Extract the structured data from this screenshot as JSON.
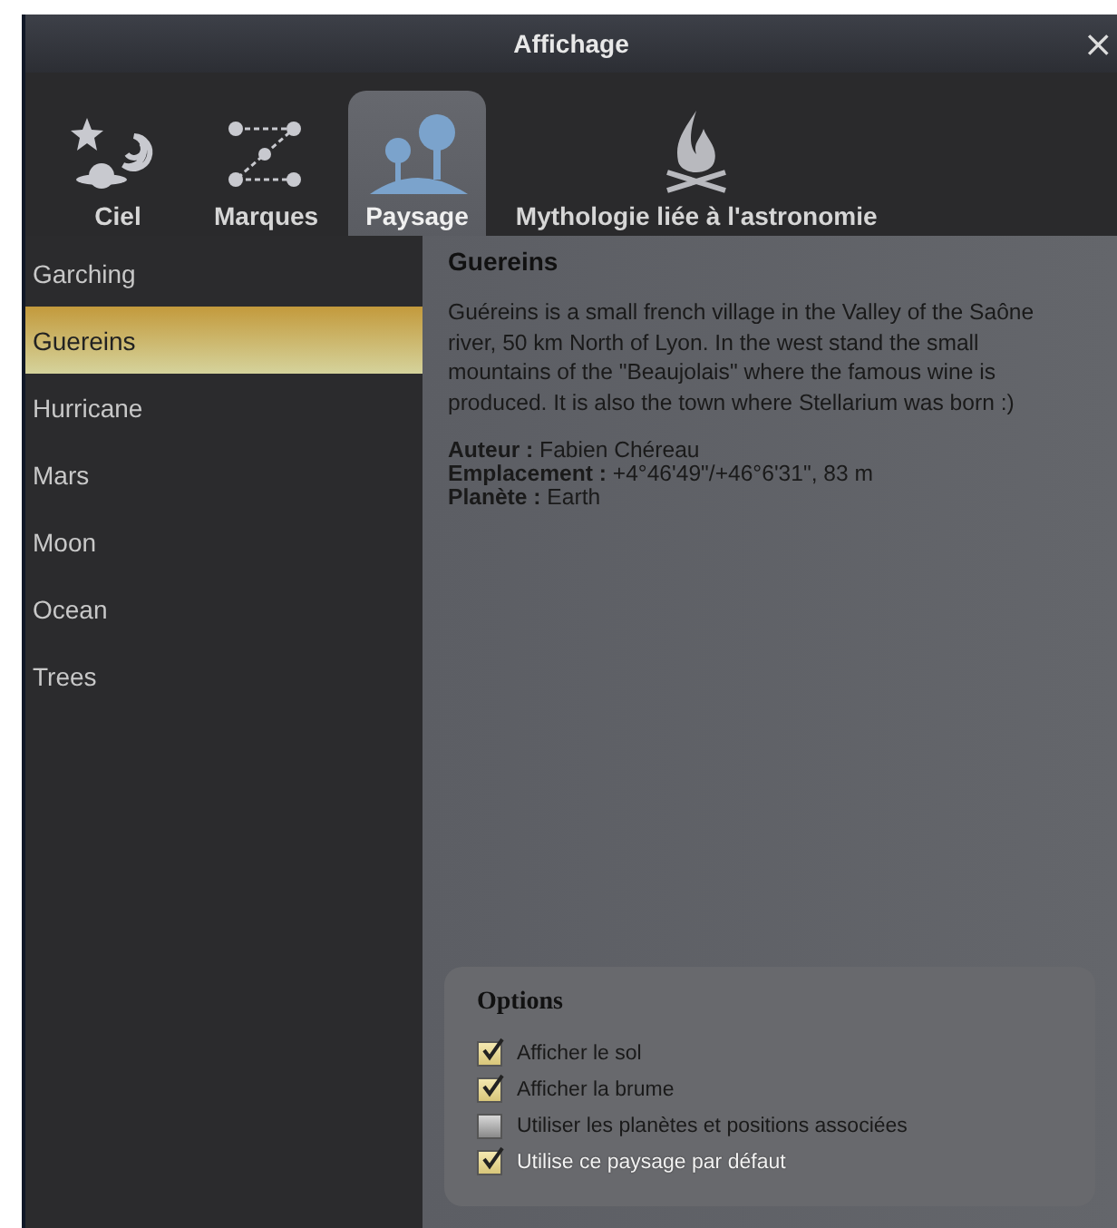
{
  "window": {
    "title": "Affichage",
    "close": "×"
  },
  "tabs": [
    {
      "label": "Ciel",
      "kind": "sky",
      "selected": false
    },
    {
      "label": "Marques",
      "kind": "markings",
      "selected": false
    },
    {
      "label": "Paysage",
      "kind": "landscape",
      "selected": true
    },
    {
      "label": "Mythologie liée à l'astronomie",
      "kind": "culture",
      "selected": false
    }
  ],
  "landscapes": [
    {
      "name": "Garching",
      "selected": false
    },
    {
      "name": "Guereins",
      "selected": true
    },
    {
      "name": "Hurricane",
      "selected": false
    },
    {
      "name": "Mars",
      "selected": false
    },
    {
      "name": "Moon",
      "selected": false
    },
    {
      "name": "Ocean",
      "selected": false
    },
    {
      "name": "Trees",
      "selected": false
    }
  ],
  "details": {
    "title": "Guereins",
    "description": "Guéreins is a small french village in the Valley of the Saône river, 50 km North of Lyon. In the west stand the small mountains of the \"Beaujolais\" where the famous wine is produced. It is also the town where Stellarium was born :)",
    "fields": [
      "**Auteur :** Fabien Chéreau",
      "**Emplacement :** +4°46'49\"/+46°6'31\", 83 m",
      "**Planète :** Earth"
    ]
  },
  "options": {
    "title": "Options",
    "items": [
      {
        "label": "Afficher le sol",
        "checked": true,
        "focused": false
      },
      {
        "label": "Afficher la brume",
        "checked": true,
        "focused": false
      },
      {
        "label": "Utiliser les planètes et positions associées",
        "checked": false,
        "focused": false
      },
      {
        "label": "Utilise ce paysage par défaut",
        "checked": true,
        "focused": true
      }
    ]
  }
}
